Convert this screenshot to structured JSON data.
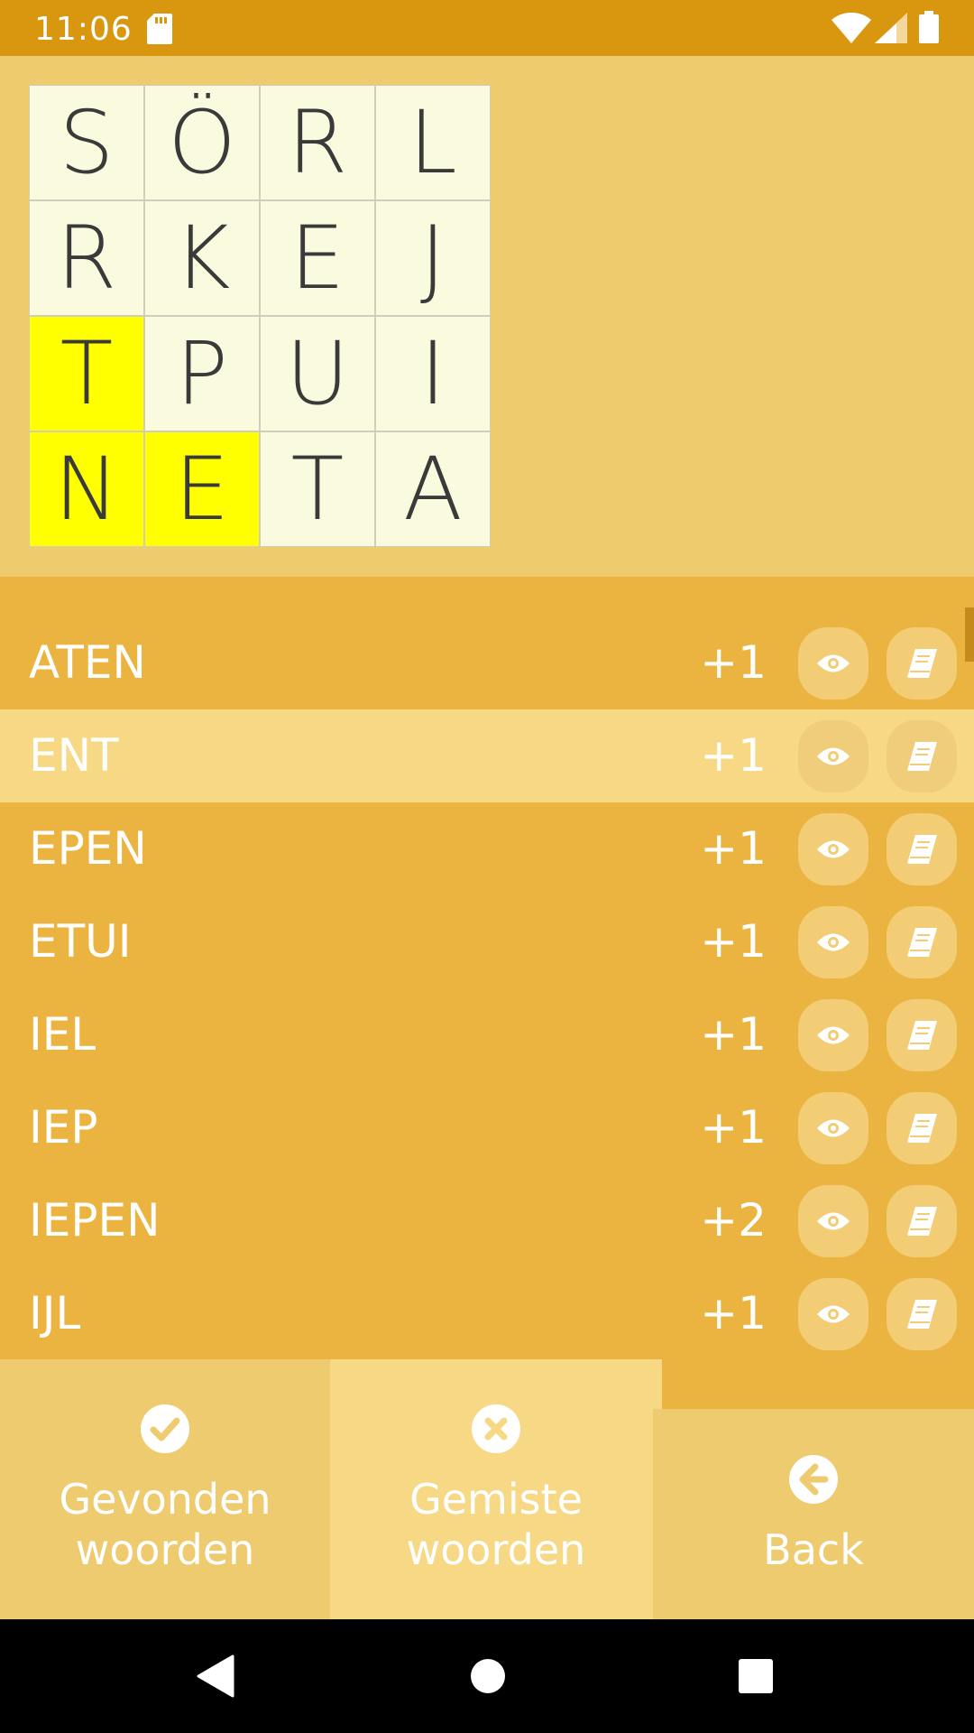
{
  "status_bar": {
    "time": "11:06"
  },
  "board": {
    "cells": [
      {
        "letter": "S",
        "highlighted": false
      },
      {
        "letter": "Ö",
        "highlighted": false
      },
      {
        "letter": "R",
        "highlighted": false
      },
      {
        "letter": "L",
        "highlighted": false
      },
      {
        "letter": "R",
        "highlighted": false
      },
      {
        "letter": "K",
        "highlighted": false
      },
      {
        "letter": "E",
        "highlighted": false
      },
      {
        "letter": "J",
        "highlighted": false
      },
      {
        "letter": "T",
        "highlighted": true
      },
      {
        "letter": "P",
        "highlighted": false
      },
      {
        "letter": "U",
        "highlighted": false
      },
      {
        "letter": "I",
        "highlighted": false
      },
      {
        "letter": "N",
        "highlighted": true
      },
      {
        "letter": "E",
        "highlighted": true
      },
      {
        "letter": "T",
        "highlighted": false
      },
      {
        "letter": "A",
        "highlighted": false
      }
    ]
  },
  "words": [
    {
      "word": "ATEN",
      "points": "+1",
      "selected": false
    },
    {
      "word": "ENT",
      "points": "+1",
      "selected": true
    },
    {
      "word": "EPEN",
      "points": "+1",
      "selected": false
    },
    {
      "word": "ETUI",
      "points": "+1",
      "selected": false
    },
    {
      "word": "IEL",
      "points": "+1",
      "selected": false
    },
    {
      "word": "IEP",
      "points": "+1",
      "selected": false
    },
    {
      "word": "IEPEN",
      "points": "+2",
      "selected": false
    },
    {
      "word": "IJL",
      "points": "+1",
      "selected": false
    }
  ],
  "bottom_nav": {
    "found_label": "Gevonden\nwoorden",
    "missed_label": "Gemiste\nwoorden",
    "back_label": "Back"
  },
  "colors": {
    "status_bar": "#d9970f",
    "board_background": "#eecb6c",
    "list_background": "#ebb441",
    "highlight": "#ffff00",
    "selected_row": "#f7d885"
  },
  "icons": {
    "row_actions": [
      "eye-icon",
      "book-icon"
    ],
    "tabs": [
      "check-circle-icon",
      "x-circle-icon",
      "arrow-left-circle-icon"
    ]
  }
}
